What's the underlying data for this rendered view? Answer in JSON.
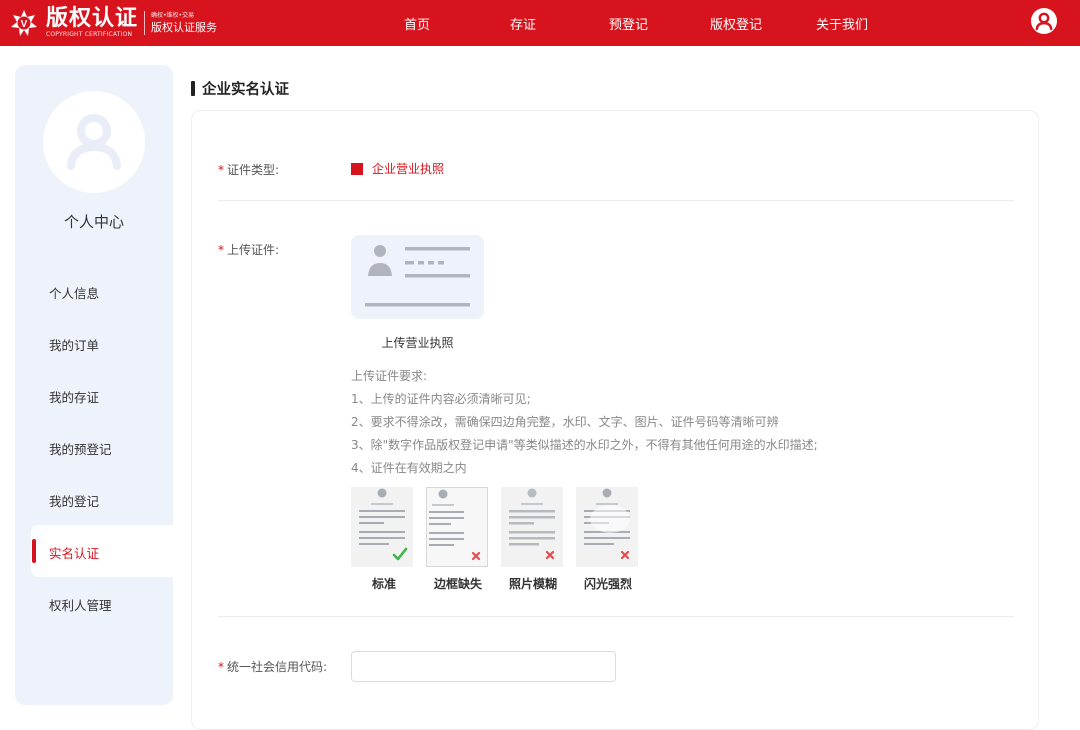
{
  "header": {
    "logo_title": "版权认证",
    "logo_en": "COPYRIGHT CERTIFICATION",
    "logo_sub1": "确权•维权•交易",
    "logo_sub2": "版权认证服务",
    "nav": [
      "首页",
      "存证",
      "预登记",
      "版权登记",
      "关于我们"
    ]
  },
  "sidebar": {
    "title": "个人中心",
    "items": [
      "个人信息",
      "我的订单",
      "我的存证",
      "我的预登记",
      "我的登记",
      "实名认证",
      "权利人管理"
    ],
    "active": "实名认证"
  },
  "main": {
    "section_title": "企业实名认证",
    "cert_type": {
      "label": "证件类型:",
      "value": "企业营业执照"
    },
    "upload": {
      "label": "上传证件:",
      "button_label": "上传营业执照",
      "requirements_title": "上传证件要求:",
      "requirements": [
        "1、上传的证件内容必须清晰可见;",
        "2、要求不得涂改，需确保四边角完整，水印、文字、图片、证件号码等清晰可辨",
        "3、除\"数字作品版权登记申请\"等类似描述的水印之外，不得有其他任何用途的水印描述;",
        "4、证件在有效期之内"
      ],
      "samples": [
        {
          "label": "标准",
          "status": "ok"
        },
        {
          "label": "边框缺失",
          "status": "bad"
        },
        {
          "label": "照片模糊",
          "status": "bad"
        },
        {
          "label": "闪光强烈",
          "status": "bad"
        }
      ]
    },
    "credit_code": {
      "label": "统一社会信用代码:",
      "value": ""
    }
  },
  "colors": {
    "brand": "#d7141e",
    "sidebar_bg": "#eef2fb",
    "ok": "#3cb54a",
    "bad": "#e94b4b"
  }
}
